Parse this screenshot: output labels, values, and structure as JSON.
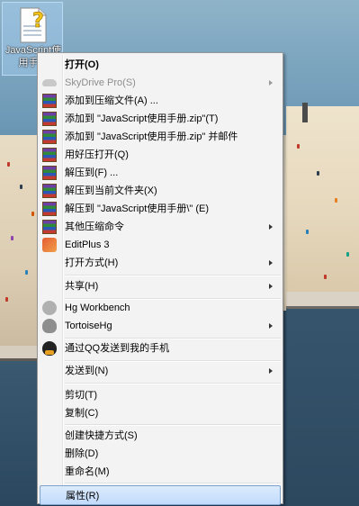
{
  "desktop_icon": {
    "label_line1": "JavaScript使",
    "label_line2": "用手册",
    "icon": "unknown-file-question-icon"
  },
  "context_menu": {
    "items": [
      {
        "label": "打开(O)",
        "bold": true
      },
      {
        "label": "SkyDrive Pro(S)",
        "disabled": true,
        "submenu": true,
        "icon": "cloud-icon"
      },
      {
        "label": "添加到压缩文件(A) ...",
        "icon": "winrar-icon"
      },
      {
        "label": "添加到 \"JavaScript使用手册.zip\"(T)",
        "icon": "winrar-icon"
      },
      {
        "label": "添加到 \"JavaScript使用手册.zip\" 并邮件",
        "icon": "winrar-icon"
      },
      {
        "label": "用好压打开(Q)",
        "icon": "winrar-icon"
      },
      {
        "label": "解压到(F) ...",
        "icon": "winrar-icon"
      },
      {
        "label": "解压到当前文件夹(X)",
        "icon": "winrar-icon"
      },
      {
        "label": "解压到 \"JavaScript使用手册\\\" (E)",
        "icon": "winrar-icon"
      },
      {
        "label": "其他压缩命令",
        "submenu": true,
        "icon": "winrar-icon"
      },
      {
        "label": "EditPlus 3",
        "icon": "editplus-icon"
      },
      {
        "label": "打开方式(H)",
        "submenu": true
      },
      {
        "label": "共享(H)",
        "submenu": true
      },
      {
        "label": "Hg Workbench",
        "icon": "hg-workbench-icon"
      },
      {
        "label": "TortoiseHg",
        "submenu": true,
        "icon": "tortoisehg-icon"
      },
      {
        "label": "通过QQ发送到我的手机",
        "icon": "qq-icon"
      },
      {
        "label": "发送到(N)",
        "submenu": true
      },
      {
        "label": "剪切(T)"
      },
      {
        "label": "复制(C)"
      },
      {
        "label": "创建快捷方式(S)"
      },
      {
        "label": "删除(D)"
      },
      {
        "label": "重命名(M)"
      },
      {
        "label": "属性(R)",
        "highlighted": true
      }
    ]
  }
}
